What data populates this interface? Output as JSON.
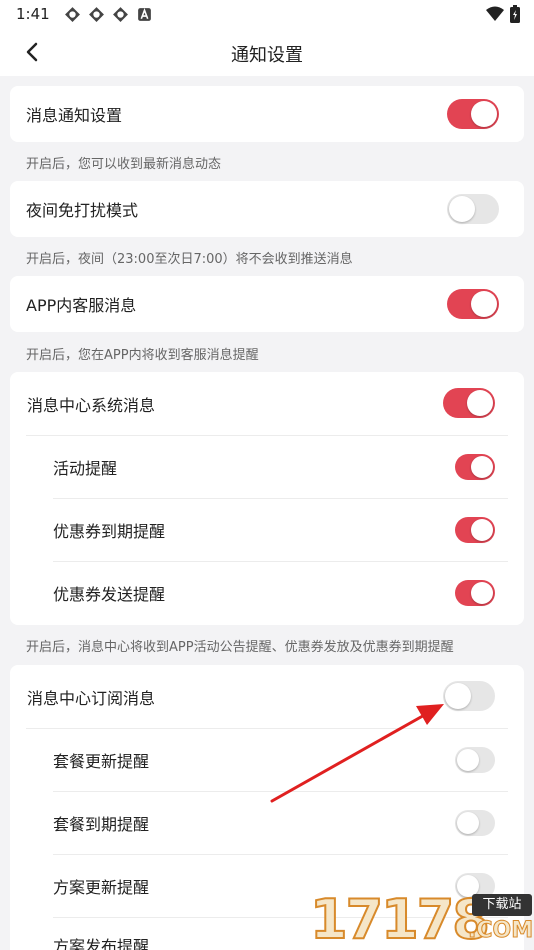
{
  "status_bar": {
    "time": "1:41",
    "notif_icons": [
      "app-icon",
      "app-icon",
      "app-icon",
      "a-icon"
    ]
  },
  "nav": {
    "title": "通知设置"
  },
  "settings": {
    "message_notify": {
      "label": "消息通知设置",
      "on": true,
      "hint": "开启后，您可以收到最新消息动态"
    },
    "night_mode": {
      "label": "夜间免打扰模式",
      "on": false,
      "hint": "开启后，夜间（23:00至次日7:00）将不会收到推送消息"
    },
    "app_service": {
      "label": "APP内客服消息",
      "on": true,
      "hint": "开启后，您在APP内将收到客服消息提醒"
    },
    "system_center": {
      "label": "消息中心系统消息",
      "on": true,
      "items": [
        {
          "label": "活动提醒",
          "on": true
        },
        {
          "label": "优惠券到期提醒",
          "on": true
        },
        {
          "label": "优惠券发送提醒",
          "on": true
        }
      ],
      "hint": "开启后，消息中心将收到APP活动公告提醒、优惠券发放及优惠券到期提醒"
    },
    "subscription_center": {
      "label": "消息中心订阅消息",
      "on": false,
      "items": [
        {
          "label": "套餐更新提醒",
          "on": false
        },
        {
          "label": "套餐到期提醒",
          "on": false
        },
        {
          "label": "方案更新提醒",
          "on": false
        },
        {
          "label": "方案发布提醒",
          "on": false
        }
      ]
    }
  },
  "watermark": {
    "digits": "17178",
    "badge": "下载站",
    "domain": ".COM"
  },
  "colors": {
    "accent": "#e24453",
    "toggle_off": "#e6e6e6",
    "annotation": "#e02020"
  }
}
